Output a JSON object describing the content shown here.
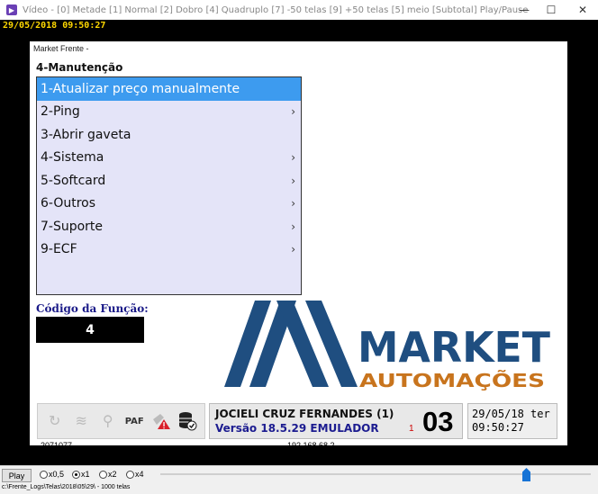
{
  "window": {
    "title": "Vídeo - [0] Metade   [1] Normal   [2] Dobro   [4] Quadruplo   [7] -50 telas   [9] +50 telas   [5] meio   [Subtotal] Play/Pause",
    "minimize": "—",
    "maximize": "☐",
    "close": "✕"
  },
  "timestamp": "29/05/2018 09:50:27",
  "app": {
    "caption": "Market Frente -",
    "menu_title": "4-Manutenção",
    "menu_items": [
      {
        "label": "1-Atualizar preço manualmente",
        "chevron": ""
      },
      {
        "label": "2-Ping",
        "chevron": "›"
      },
      {
        "label": "3-Abrir gaveta",
        "chevron": ""
      },
      {
        "label": "4-Sistema",
        "chevron": "›"
      },
      {
        "label": "5-Softcard",
        "chevron": "›"
      },
      {
        "label": "6-Outros",
        "chevron": "›"
      },
      {
        "label": "7-Suporte",
        "chevron": "›"
      },
      {
        "label": "9-ECF",
        "chevron": "›"
      }
    ],
    "function_label": "Código da Função:",
    "function_value": "4",
    "logo": {
      "word1": "MARKET",
      "word2": "AUTOMAÇÕES",
      "color": "#1f4e80"
    },
    "toolbar": {
      "paf": "PAF"
    },
    "operator": {
      "name": "JOCIELI CRUZ FERNANDES (1)",
      "version": "Versão 18.5.29  EMULADOR",
      "small_number": "1",
      "big_number": "03"
    },
    "clock": {
      "line1": "29/05/18 ter",
      "line2": "09:50:27"
    },
    "under_left": "2071077",
    "under_right": "192.168.68.2"
  },
  "player": {
    "play_label": "Play",
    "speeds": [
      "x0,5",
      "x1",
      "x2",
      "x4"
    ],
    "selected_speed": "x1",
    "progress": 0.85,
    "path": "c:\\Frente_Logs\\Telas\\2018\\05\\29\\ - 1000 telas"
  }
}
